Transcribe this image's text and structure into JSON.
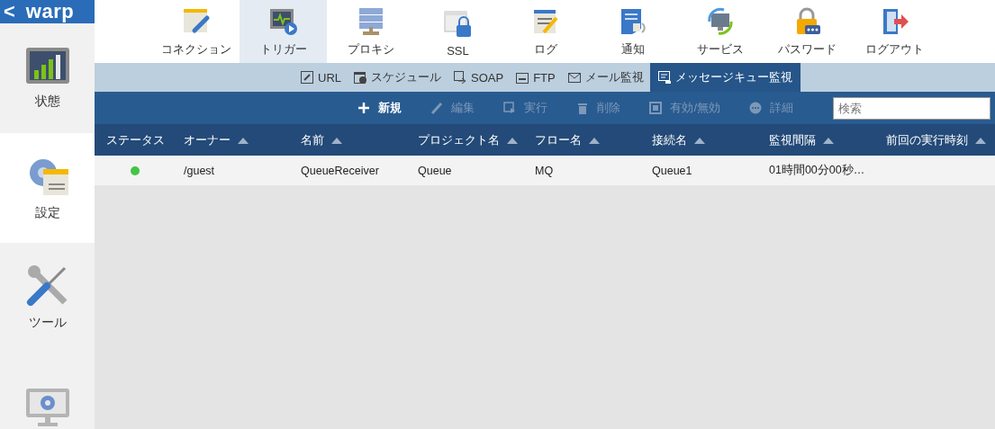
{
  "logo": {
    "back": "<",
    "title": "warp"
  },
  "sidebar": {
    "items": [
      {
        "label": "状態",
        "selected": false
      },
      {
        "label": "設定",
        "selected": true
      },
      {
        "label": "ツール",
        "selected": false
      },
      {
        "selected": false
      }
    ]
  },
  "nav": {
    "items": [
      {
        "label": "コネクション",
        "selected": false
      },
      {
        "label": "トリガー",
        "selected": true
      },
      {
        "label": "プロキシ",
        "selected": false
      },
      {
        "label": "SSL",
        "selected": false
      },
      {
        "label": "ログ",
        "selected": false
      },
      {
        "label": "通知",
        "selected": false
      },
      {
        "label": "サービス",
        "selected": false
      },
      {
        "label": "パスワード",
        "selected": false
      },
      {
        "label": "ログアウト",
        "selected": false
      }
    ]
  },
  "tabs": [
    {
      "label": "URL",
      "selected": false
    },
    {
      "label": "スケジュール",
      "selected": false
    },
    {
      "label": "SOAP",
      "selected": false
    },
    {
      "label": "FTP",
      "selected": false
    },
    {
      "label": "メール監視",
      "selected": false
    },
    {
      "label": "メッセージキュー監視",
      "selected": true
    }
  ],
  "toolbar": {
    "buttons": [
      {
        "label": "新規",
        "disabled": false
      },
      {
        "label": "編集",
        "disabled": true
      },
      {
        "label": "実行",
        "disabled": true
      },
      {
        "label": "削除",
        "disabled": true
      },
      {
        "label": "有効/無効",
        "disabled": true
      },
      {
        "label": "詳細",
        "disabled": true
      }
    ],
    "search": {
      "placeholder": "検索"
    }
  },
  "table": {
    "columns": [
      {
        "label": "ステータス",
        "sortable": false
      },
      {
        "label": "オーナー",
        "sortable": true
      },
      {
        "label": "名前",
        "sortable": true
      },
      {
        "label": "プロジェクト名",
        "sortable": true
      },
      {
        "label": "フロー名",
        "sortable": true
      },
      {
        "label": "接続名",
        "sortable": true
      },
      {
        "label": "監視間隔",
        "sortable": true
      },
      {
        "label": "前回の実行時刻",
        "sortable": true
      }
    ],
    "rows": [
      {
        "color": "#44c444",
        "cells": [
          "",
          "/guest",
          "QueueReceiver",
          "Queue",
          "MQ",
          "Queue1",
          "01時間00分00秒…"
        ]
      }
    ]
  }
}
